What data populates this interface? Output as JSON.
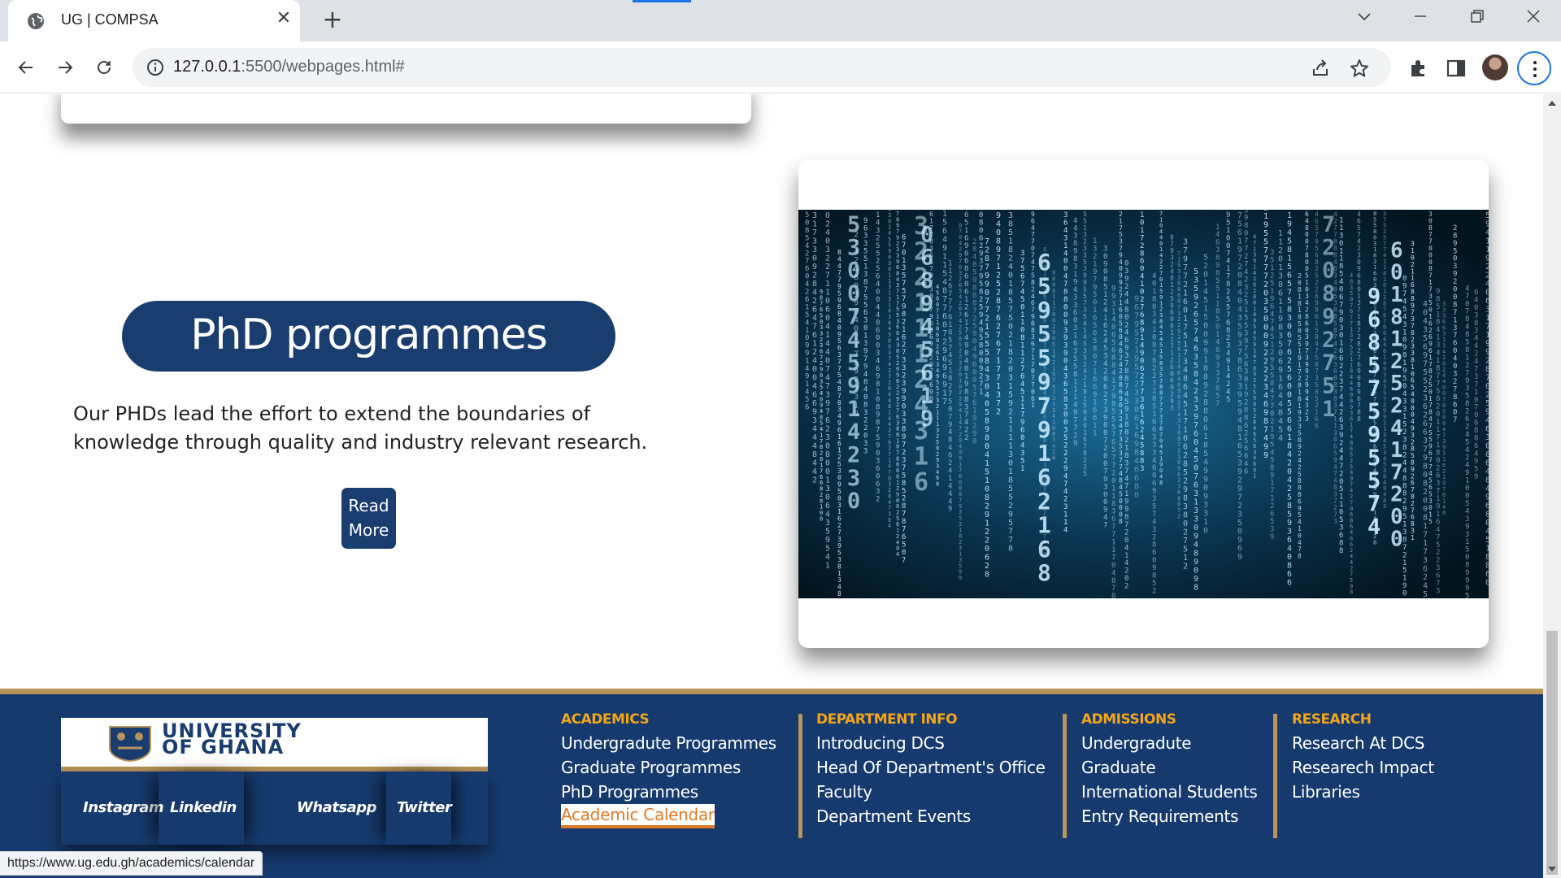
{
  "browser": {
    "tab_title": "UG | COMPSA",
    "url_host": "127.0.0.1",
    "url_rest": ":5500/webpages.html#",
    "status_url": "https://www.ug.edu.gh/academics/calendar"
  },
  "phd": {
    "heading": "PhD programmes",
    "description": "Our PHDs lead the effort to extend the boundaries of knowledge through quality and industry relevant research.",
    "read_more": "Read More"
  },
  "footer": {
    "logo_line1": "UNIVERSITY",
    "logo_line2": "OF GHANA",
    "social": [
      "Instagram",
      "Linkedin",
      "Whatsapp",
      "Twitter"
    ],
    "columns": [
      {
        "heading": "ACADEMICS",
        "links": [
          "Undergradute Programmes",
          "Graduate Programmes",
          "PhD Programmes",
          "Academic Calendar"
        ]
      },
      {
        "heading": "DEPARTMENT INFO",
        "links": [
          "Introducing DCS",
          "Head Of Department's Office",
          "Faculty",
          "Department Events"
        ]
      },
      {
        "heading": "ADMISSIONS",
        "links": [
          "Undergradute",
          "Graduate",
          "International Students",
          "Entry Requirements"
        ]
      },
      {
        "heading": "RESEARCH",
        "links": [
          "Research At DCS",
          "Researech Impact",
          "Libraries"
        ]
      }
    ]
  },
  "colors": {
    "navy": "#1a3d70",
    "footer_bg": "#163a6e",
    "gold": "#b8935a",
    "heading_orange": "#f2a51a",
    "active_link": "#e07a28"
  },
  "icons": [
    "globe-icon",
    "close-icon",
    "plus-icon",
    "chevron-down-icon",
    "minimize-icon",
    "restore-icon",
    "window-close-icon",
    "back-arrow-icon",
    "forward-arrow-icon",
    "reload-icon",
    "info-icon",
    "share-icon",
    "star-icon",
    "extensions-icon",
    "side-panel-icon",
    "profile-avatar",
    "kebab-menu-icon"
  ]
}
